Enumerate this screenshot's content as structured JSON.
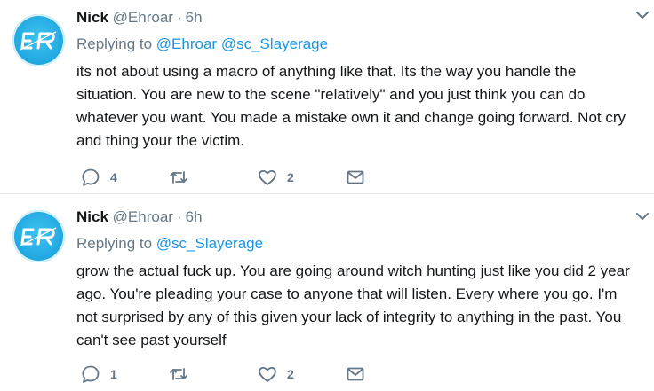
{
  "tweets": [
    {
      "name": "Nick",
      "handle": "@Ehroar",
      "time": "6h",
      "replying_prefix": "Replying to",
      "mentions": [
        "@Ehroar",
        "@sc_Slayerage"
      ],
      "text": "its not about using a macro of anything like that. Its the way you handle the situation. You are new to the scene \"relatively\" and you just think you can do whatever you want. You made a mistake own it and change going forward. Not cry and thing your the victim.",
      "reply_count": "4",
      "retweet_count": "",
      "like_count": "2"
    },
    {
      "name": "Nick",
      "handle": "@Ehroar",
      "time": "6h",
      "replying_prefix": "Replying to",
      "mentions": [
        "@sc_Slayerage"
      ],
      "text": "grow the actual fuck up. You are going around witch hunting just like you did 2 year ago. You're pleading your case to anyone that will listen. Every where you go. I'm not surprised by any of this given your lack of integrity to anything in the past. You can't see past yourself",
      "reply_count": "1",
      "retweet_count": "",
      "like_count": "2"
    }
  ],
  "icons": {
    "reply": "reply-icon",
    "retweet": "retweet-icon",
    "like": "heart-icon",
    "dm": "envelope-icon",
    "more": "chevron-down-icon"
  },
  "colors": {
    "link": "#1b95e0",
    "muted": "#657786",
    "text": "#14171a",
    "avatar": "#1fa6df"
  }
}
